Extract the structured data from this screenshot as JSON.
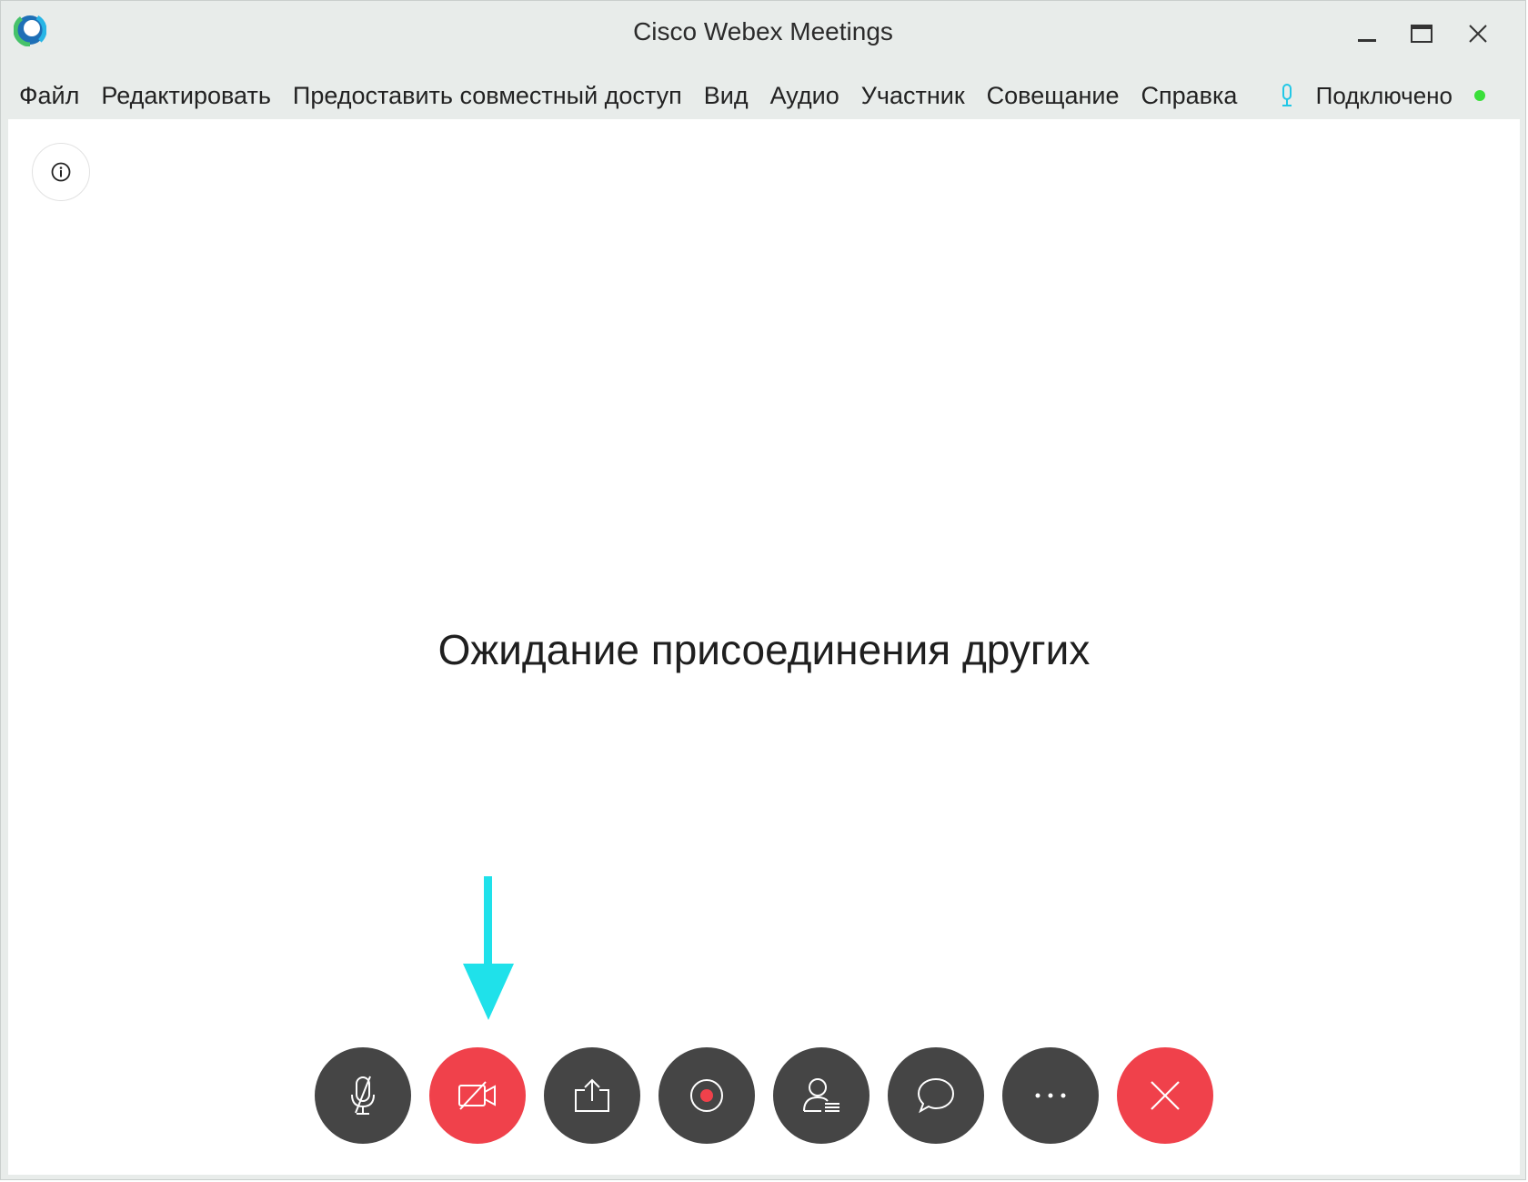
{
  "window": {
    "title": "Cisco Webex Meetings"
  },
  "menu": {
    "items": [
      {
        "label": "Файл"
      },
      {
        "label": "Редактировать"
      },
      {
        "label": "Предоставить совместный доступ"
      },
      {
        "label": "Вид"
      },
      {
        "label": "Аудио"
      },
      {
        "label": "Участник"
      },
      {
        "label": "Совещание"
      },
      {
        "label": "Справка"
      }
    ]
  },
  "status": {
    "text": "Подключено",
    "mic_icon": "microphone-icon",
    "dot_color": "#3adf3a"
  },
  "main": {
    "message": "Ожидание присоединения других"
  },
  "controls": [
    {
      "icon": "microphone-muted-icon",
      "state": "muted"
    },
    {
      "icon": "video-off-icon",
      "state": "video stopped",
      "color": "#f0414b"
    },
    {
      "icon": "share-icon"
    },
    {
      "icon": "record-icon"
    },
    {
      "icon": "participants-icon"
    },
    {
      "icon": "chat-icon"
    },
    {
      "icon": "more-icon"
    },
    {
      "icon": "leave-meeting-icon",
      "color": "#f0414b"
    }
  ],
  "colors": {
    "accent_red": "#f0414b",
    "control_dark": "#454545",
    "annotation_arrow": "#1fe1ea",
    "status_green": "#3adf3a",
    "mic_status_blue": "#22c7e6"
  }
}
